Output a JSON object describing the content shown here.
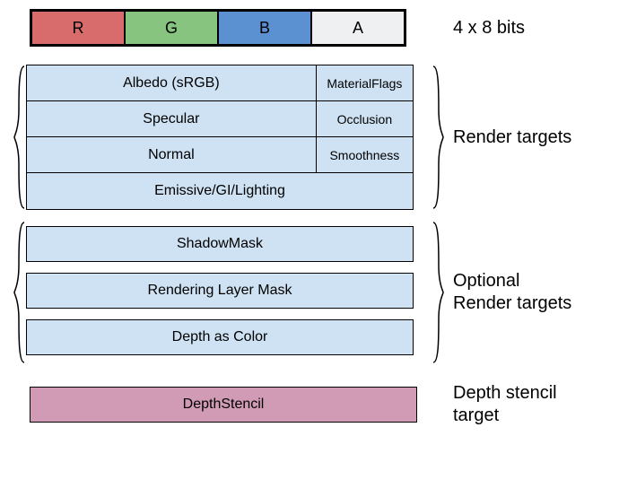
{
  "header": {
    "channels": {
      "r": "R",
      "g": "G",
      "b": "B",
      "a": "A"
    },
    "label": "4 x 8 bits"
  },
  "renderTargets": {
    "label": "Render targets",
    "rows": [
      {
        "main": "Albedo (sRGB)",
        "a": "MaterialFlags"
      },
      {
        "main": "Specular",
        "a": "Occlusion"
      },
      {
        "main": "Normal",
        "a": "Smoothness"
      },
      {
        "full": "Emissive/GI/Lighting"
      }
    ]
  },
  "optionalTargets": {
    "label": "Optional\nRender targets",
    "rows": [
      "ShadowMask",
      "Rendering Layer Mask",
      "Depth as Color"
    ]
  },
  "depthStencil": {
    "row": "DepthStencil",
    "label": "Depth stencil target"
  }
}
